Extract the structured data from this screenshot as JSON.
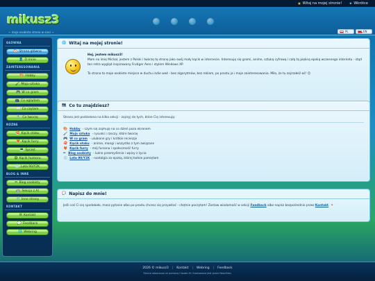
{
  "topbar": {
    "welcome": "Witaj na mojej stronie!",
    "back": "Wkrótce"
  },
  "header": {
    "logo": "mikusz3",
    "tagline": "~ moja osobista strona w sieci ~",
    "lang_pl": "PL",
    "lang_en": "EN"
  },
  "sidebar": {
    "sections": [
      {
        "label": "GŁÓWNA",
        "items": [
          {
            "label": "Strona główna",
            "icon": "home-icon",
            "glyph": "🏠",
            "active": true
          },
          {
            "label": "O mnie",
            "icon": "person-icon",
            "glyph": "👤"
          }
        ]
      },
      {
        "label": "ZAINTERESOWANIA",
        "items": [
          {
            "label": "Hobby",
            "icon": "palette-icon",
            "glyph": "🎨"
          },
          {
            "label": "Moja sztuka",
            "icon": "brush-icon",
            "glyph": "🖌"
          },
          {
            "label": "W co gram",
            "icon": "gamepad-icon",
            "glyph": "🎮"
          },
          {
            "label": "Co oglądam",
            "icon": "tv-icon",
            "glyph": "📺"
          },
          {
            "label": "Co czytam",
            "icon": "book-icon",
            "glyph": "📖"
          },
          {
            "label": "Co tworzę",
            "icon": "wrench-icon",
            "glyph": "🔧"
          }
        ]
      },
      {
        "label": "RÓŻNE",
        "items": [
          {
            "label": "Kącik otaku",
            "icon": "sushi-icon",
            "glyph": "🍣"
          },
          {
            "label": "Kącik furry",
            "icon": "paw-icon",
            "glyph": "🦊"
          },
          {
            "label": "Sprzęt",
            "icon": "computer-icon",
            "glyph": "💻"
          },
          {
            "label": "Kącik humoru",
            "icon": "laugh-icon",
            "glyph": "😄"
          },
          {
            "label": "Lata 90/Y2K",
            "icon": "disc-icon",
            "glyph": "💿"
          }
        ]
      },
      {
        "label": "BLOG & INNE",
        "items": [
          {
            "label": "Blog osobisty",
            "icon": "pencil-icon",
            "glyph": "✏"
          },
          {
            "label": "Sekcja z AI",
            "icon": "robot-icon",
            "glyph": "🤖"
          },
          {
            "label": "Inne strony",
            "icon": "link-icon",
            "glyph": "🔗"
          }
        ]
      },
      {
        "label": "KONTAKT",
        "items": [
          {
            "label": "Kontakt",
            "icon": "mail-icon",
            "glyph": "✉"
          },
          {
            "label": "Feedback",
            "icon": "chat-icon",
            "glyph": "💬"
          },
          {
            "label": "Webring",
            "icon": "globe-icon",
            "glyph": "🌐"
          }
        ]
      }
    ]
  },
  "welcome_panel": {
    "title": "Witaj na mojej stronie!",
    "greeting": "Hej, jestem mikusz3!",
    "para1": "Mam na imię Michał, jestem z Polski i tworzę tę stronę jako swój mały kącik w internecie. Interesuję się grami, anime, sztuką cyfrową i całą tą piękną epoką wczesnego internetu - stąd ten retro wygląd inspirowany Frutiger Aero i stylem Windows XP.",
    "para2_before": "Ta strona to moje osobiste miejsce w duchu ",
    "para2_em": "indie web",
    "para2_after": " - bez algorytmów, bez reklam, po prostu ja i moje zainteresowania. Miło, że tu zajrzałeś/-aś! 😊"
  },
  "sections_panel": {
    "title": "Co tu znajdziesz?",
    "intro": "Strona jest podzielona na kilka sekcji - zajrzyj do tych, które Cię interesują:",
    "items": [
      {
        "glyph": "🎨",
        "icon": "palette-icon",
        "link": "Hobby",
        "desc": " - czym się zajmuję na co dzień poza ekranem"
      },
      {
        "glyph": "🖌",
        "icon": "brush-icon",
        "link": "Moja sztuka",
        "desc": " - rysunki i rzeczy, które tworzę"
      },
      {
        "glyph": "🎮",
        "icon": "gamepad-icon",
        "link": "W co gram",
        "desc": " - ulubione gry i krótkie recenzje"
      },
      {
        "glyph": "🍣",
        "icon": "sushi-icon",
        "link": "Kącik otaku",
        "desc": " - anime, mangi i wszystko z tym związane"
      },
      {
        "glyph": "🦊",
        "icon": "paw-icon",
        "link": "Kącik furry",
        "desc": " - mój fursona i społeczność furry"
      },
      {
        "glyph": "✏",
        "icon": "pencil-icon",
        "link": "Blog osobisty",
        "desc": " - luźne przemyślenia i wpisy z życia"
      },
      {
        "glyph": "💿",
        "icon": "disc-icon",
        "link": "Lata 90/Y2K",
        "desc": " - nostalgia za epoką, której ładnie pamiętam"
      }
    ]
  },
  "contact_panel": {
    "title": "Napisz do mnie!",
    "text_before": "Jeśli coś Ci się spodobało, masz pytanie albo po prostu chcesz się przywitać - chętnie poczytam! Zostaw wiadomość w sekcji ",
    "link1": "Feedback",
    "text_mid": " albo napisz bezpośrednio przez ",
    "link2": "Kontakt",
    "text_after": ". 💌"
  },
  "footer": {
    "copyright": "2026 © mikusz3",
    "links": [
      "Kontakt",
      "Webring",
      "Feedback"
    ],
    "small": "Strona stworzona ze pomocą Claude AI i hostowana jest przez Neocities."
  },
  "colors": {
    "accent_green": "#8be35c",
    "accent_blue": "#3aa3e0",
    "panel_bg": "#eaf7fd",
    "sidebar_bg": "#072d52"
  }
}
